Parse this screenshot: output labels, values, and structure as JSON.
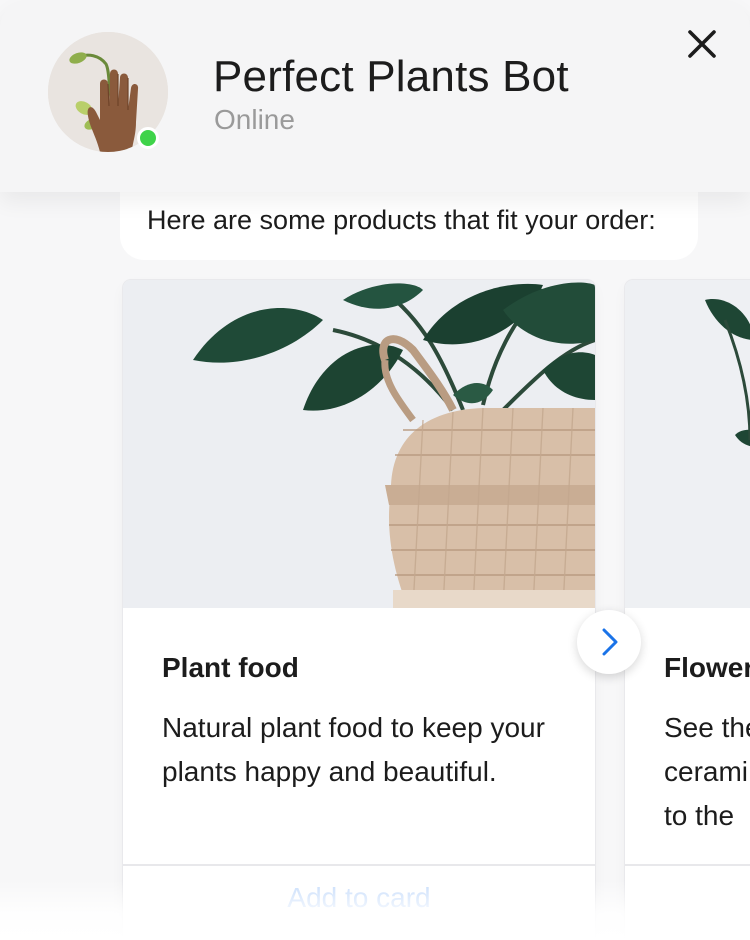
{
  "header": {
    "bot_name": "Perfect Plants Bot",
    "status": "Online",
    "status_color": "#3fd34a",
    "avatar_icon": "hand-holding-plant-avatar",
    "close_icon": "close-icon"
  },
  "message": {
    "text": "Here are some products that fit your order:"
  },
  "products": [
    {
      "title": "Plant food",
      "description": "Natural plant food to keep your plants happy and beautiful.",
      "action": "Add to card",
      "image_icon": "potted-plant-in-basket-image"
    },
    {
      "title": "Flower",
      "description_lines": [
        "See the",
        "cerami",
        "to the"
      ],
      "image_icon": "plant-leaf-image"
    }
  ],
  "carousel": {
    "next_icon": "chevron-right-icon"
  },
  "colors": {
    "accent": "#1a73e8",
    "action_text": "#c6dcfb",
    "status_online": "#3fd34a"
  }
}
